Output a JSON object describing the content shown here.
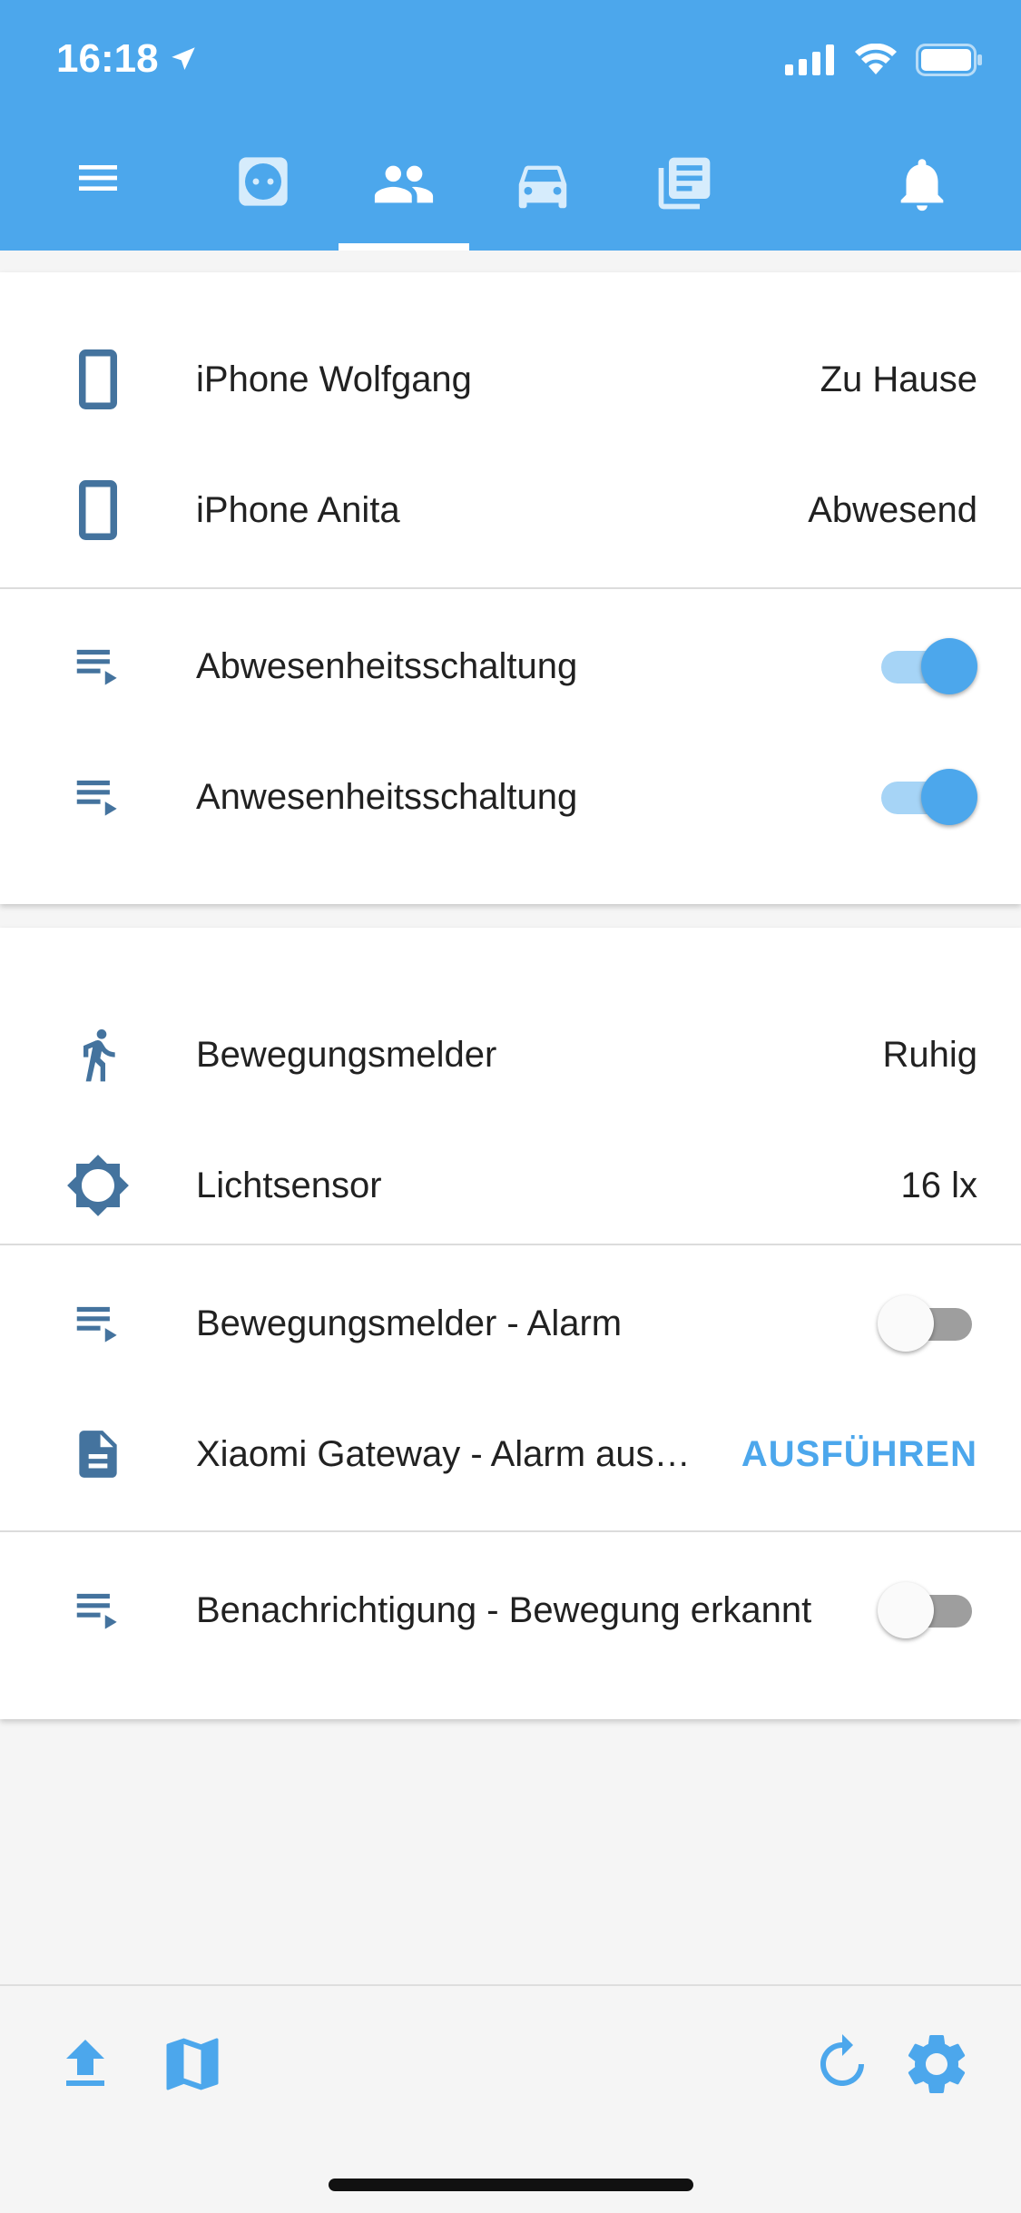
{
  "status_bar": {
    "time": "16:18"
  },
  "tabs": [
    {
      "name": "menu-icon"
    },
    {
      "name": "socket-icon"
    },
    {
      "name": "people-icon",
      "active": true
    },
    {
      "name": "car-icon"
    },
    {
      "name": "news-icon"
    },
    {
      "name": "bell-icon"
    }
  ],
  "card1": {
    "devices": [
      {
        "label": "iPhone Wolfgang",
        "value": "Zu Hause"
      },
      {
        "label": "iPhone Anita",
        "value": "Abwesend"
      }
    ],
    "scripts": [
      {
        "label": "Abwesenheitsschaltung",
        "state": "on"
      },
      {
        "label": "Anwesenheitsschaltung",
        "state": "on"
      }
    ]
  },
  "card2": {
    "sensors": [
      {
        "label": "Bewegungsmelder",
        "value": "Ruhig"
      },
      {
        "label": "Lichtsensor",
        "value": "16 lx"
      }
    ],
    "automation": {
      "label": "Bewegungsmelder - Alarm",
      "state": "off"
    },
    "script": {
      "label": "Xiaomi Gateway - Alarm aus…",
      "action": "AUSFÜHREN"
    },
    "notify": {
      "label": "Benachrichtigung - Bewegung erkannt",
      "state": "off"
    }
  },
  "bottom_bar": [
    {
      "name": "upload-icon"
    },
    {
      "name": "map-icon"
    },
    {
      "name": "refresh-icon"
    },
    {
      "name": "settings-icon"
    }
  ],
  "colors": {
    "header": "#4ca7ec",
    "icon": "#44739e",
    "accent": "#4ca7ec"
  }
}
